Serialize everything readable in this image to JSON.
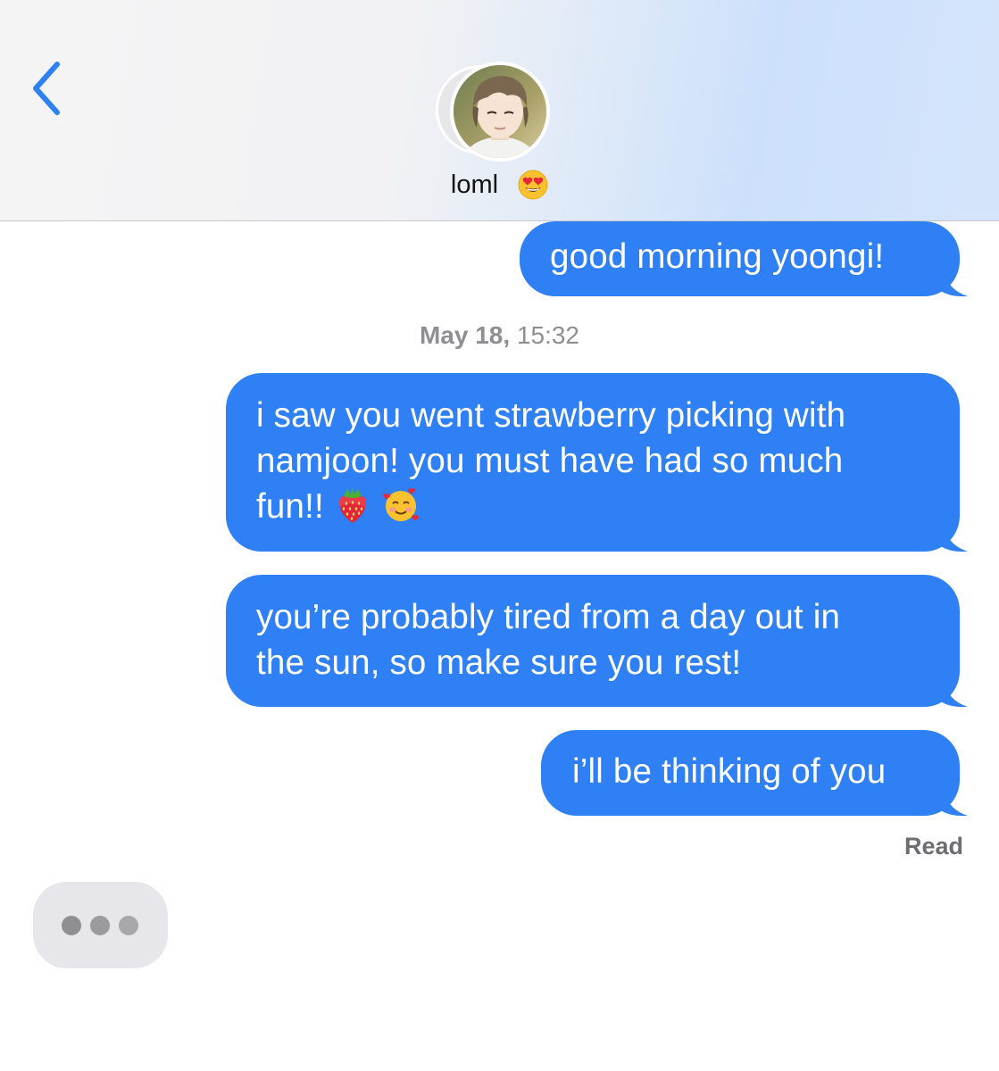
{
  "header": {
    "contact_name": "loml",
    "name_emoji": "heart-eyes-emoji",
    "back_icon": "chevron-left-icon",
    "accent_color": "#2f80f5"
  },
  "messages": [
    {
      "sender": "me",
      "lines": [
        "good morning yoongi!"
      ]
    },
    {
      "sender": "me",
      "lines": [
        "i saw you went strawberry picking with",
        "namjoon! you must have had so much",
        "fun!!"
      ],
      "emojis": [
        "strawberry-emoji",
        "smiling-face-with-hearts-emoji"
      ]
    },
    {
      "sender": "me",
      "lines": [
        "you’re probably tired from a day out in",
        "the sun, so make sure you rest!"
      ]
    },
    {
      "sender": "me",
      "lines": [
        "i’ll be thinking of you"
      ]
    }
  ],
  "timestamp": {
    "date": "May 18,",
    "time": "15:32"
  },
  "read_receipt": "Read",
  "typing_indicator": {
    "dots": 3,
    "bubble_color": "#e6e6eb"
  },
  "colors": {
    "sent_bubble": "#2f80f5",
    "timestamp_text": "#8e8e93"
  }
}
